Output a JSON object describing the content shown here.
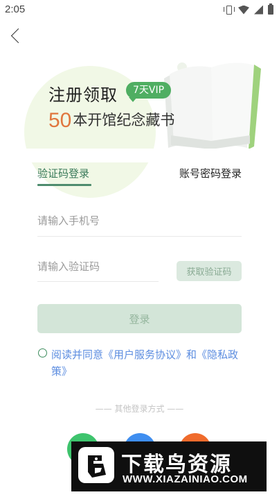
{
  "status_bar": {
    "time": "2:05",
    "icons": [
      "vibrate-icon",
      "wifi-icon",
      "signal-icon",
      "battery-icon"
    ]
  },
  "nav": {
    "back_icon": "chevron-left-icon"
  },
  "banner": {
    "headline": "注册领取",
    "vip_badge": "7天VIP",
    "subline_number": "50",
    "subline_text": "本开馆纪念藏书",
    "colors": {
      "green": "#4fae62",
      "orange": "#e0763e"
    }
  },
  "tabs": [
    {
      "label": "验证码登录",
      "active": true
    },
    {
      "label": "账号密码登录",
      "active": false
    }
  ],
  "form": {
    "phone_placeholder": "请输入手机号",
    "phone_value": "",
    "code_placeholder": "请输入验证码",
    "code_value": "",
    "get_code_label": "获取验证码",
    "login_label": "登录"
  },
  "agreement": {
    "checked": false,
    "prefix": "阅读并同意",
    "user_agreement": "《用户服务协议》",
    "joiner": "和",
    "privacy_policy": "《隐私政策》"
  },
  "other_login": {
    "label": "—— 其他登录方式 ——",
    "providers": [
      {
        "name": "wechat-icon",
        "color": "#3ec46d"
      },
      {
        "name": "qq-icon",
        "color": "#3f8ef0"
      },
      {
        "name": "weibo-icon",
        "color": "#f06b2c"
      }
    ]
  },
  "watermark": {
    "title": "下载鸟资源",
    "url": "WWW.XIAZAINIAO.COM"
  }
}
